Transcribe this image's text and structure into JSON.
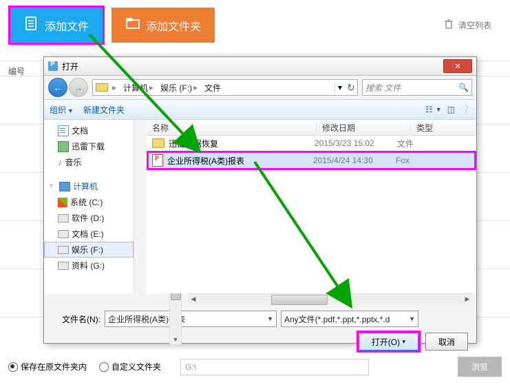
{
  "toolbar": {
    "add_file": "添加文件",
    "add_folder": "添加文件夹",
    "clear_list": "清空列表"
  },
  "numcol_label": "编号",
  "dialog": {
    "title": "打开",
    "breadcrumb": {
      "computer": "计算机",
      "drive": "娱乐 (F:)",
      "folder": "文件"
    },
    "search_placeholder": "搜索 文件",
    "toolbar": {
      "organize": "组织",
      "new_folder": "新建文件夹"
    },
    "tree": {
      "doc": "文档",
      "download": "迅雷下载",
      "music": "音乐",
      "computer": "计算机",
      "sys_c": "系统 (C:)",
      "soft_d": "软件 (D:)",
      "doc_e": "文档 (E:)",
      "ent_f": "娱乐 (F:)",
      "data_g": "资料 (G:)"
    },
    "cols": {
      "name": "名称",
      "date": "修改日期",
      "type": "类型"
    },
    "rows": [
      {
        "name": "迅捷数据恢复",
        "date": "2015/3/23 15:02",
        "type": "文件"
      },
      {
        "name": "企业所得税(A类)报表",
        "date": "2015/4/24 14:30",
        "type": "Fox"
      }
    ],
    "filename_label": "文件名(N):",
    "filename_value": "企业所得税(A类)报表",
    "filter": "Any文件(*.pdf,*.ppt,*.pptx,*.d",
    "open_btn": "打开(O)",
    "cancel_btn": "取消"
  },
  "bottom": {
    "save_in_source": "保存在原文件夹内",
    "custom_folder": "自定义文件夹",
    "path": "G:\\",
    "browse": "浏览"
  }
}
